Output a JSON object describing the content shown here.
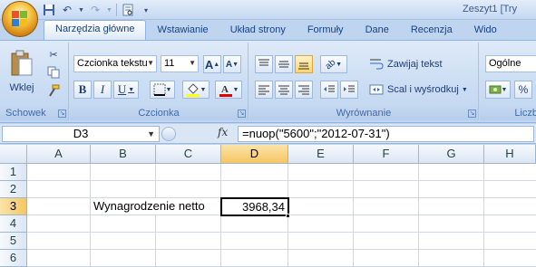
{
  "window": {
    "title": "Zeszyt1 [Try"
  },
  "tabs": [
    {
      "label": "Narzędzia główne",
      "active": true
    },
    {
      "label": "Wstawianie"
    },
    {
      "label": "Układ strony"
    },
    {
      "label": "Formuły"
    },
    {
      "label": "Dane"
    },
    {
      "label": "Recenzja"
    },
    {
      "label": "Wido"
    }
  ],
  "ribbon": {
    "clipboard": {
      "label": "Schowek",
      "paste_label": "Wklej"
    },
    "font": {
      "label": "Czcionka",
      "font_name": "Czcionka tekstu",
      "font_size": "11",
      "bold": "B",
      "italic": "I",
      "underline": "U",
      "grow": "A",
      "shrink": "A"
    },
    "alignment": {
      "label": "Wyrównanie",
      "wrap_text": "Zawijaj tekst",
      "merge_center": "Scal i wyśrodkuj"
    },
    "number": {
      "label": "Liczb",
      "format": "Ogólne",
      "percent": "%"
    }
  },
  "formula_bar": {
    "name_box": "D3",
    "fx": "fx",
    "formula": "=nuop(\"5600\";\"2012-07-31\")"
  },
  "sheet": {
    "columns": [
      "A",
      "B",
      "C",
      "D",
      "E",
      "F",
      "G",
      "H"
    ],
    "selected_column": "D",
    "rows": [
      "1",
      "2",
      "3",
      "4",
      "5",
      "6"
    ],
    "selected_row": "3",
    "cells": {
      "B3": "Wynagrodzenie netto",
      "D3": "3968,34"
    }
  },
  "colors": {
    "accent": "#15428b",
    "selection": "#f5c662"
  }
}
